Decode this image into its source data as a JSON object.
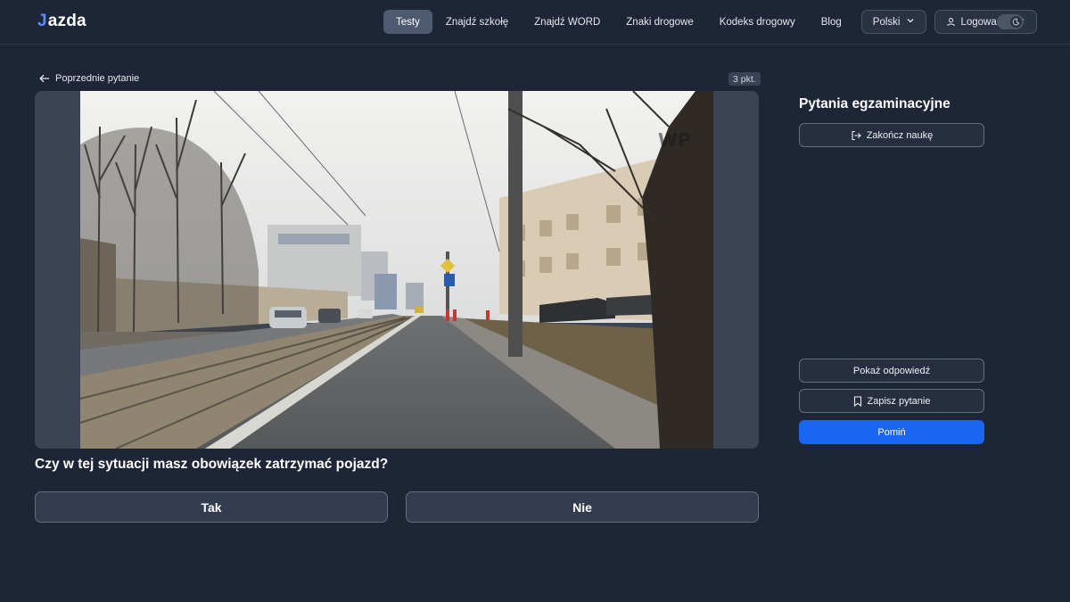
{
  "header": {
    "logo_mark": "J",
    "logo_text": "azda",
    "nav": [
      {
        "label": "Testy",
        "active": true
      },
      {
        "label": "Znajdź szkołę"
      },
      {
        "label": "Znajdź WORD"
      },
      {
        "label": "Znaki drogowe"
      },
      {
        "label": "Kodeks drogowy"
      },
      {
        "label": "Blog"
      }
    ],
    "language": "Polski",
    "login": "Logowanie",
    "icons": {
      "chevron": "chevron-down-icon",
      "user": "user-icon",
      "theme": "moon-icon"
    }
  },
  "main": {
    "back_label": "Poprzednie pytanie",
    "points": "3 pkt.",
    "question": "Czy w tej sytuacji masz obowiązek zatrzymać pojazd?",
    "answers": [
      {
        "label": "Tak"
      },
      {
        "label": "Nie"
      }
    ]
  },
  "sidebar": {
    "title": "Pytania egzaminacyjne",
    "finish_label": "Zakończ naukę",
    "show_answer_label": "Pokaż odpowiedź",
    "save_label": "Zapisz pytanie",
    "skip_label": "Pomiń"
  },
  "colors": {
    "background": "#1e2536",
    "accent": "#1a66f0",
    "nav_active": "#4d5a70"
  }
}
